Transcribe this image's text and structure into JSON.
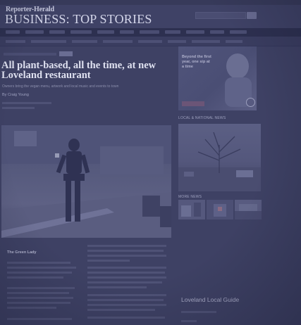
{
  "header": {
    "brand": "Reporter-Herald",
    "section_title": "BUSINESS: TOP STORIES"
  },
  "article": {
    "headline": "All plant-based, all the time, at new Loveland restaurant",
    "deck": "Owners bring the vegan menu, artwork and local music and events to town",
    "byline": "By Craig Young"
  },
  "caption": {
    "title": "The Green Lady"
  },
  "ad": {
    "line1": "Beyond the first",
    "line2": "year, one sip at",
    "line3": "a time"
  },
  "rail": {
    "photo_heading": "LOCAL & NATIONAL NEWS",
    "thumbs_heading": "MORE NEWS",
    "local_guide": "Loveland Local Guide"
  },
  "colors": {
    "header_bg": "#3f4266",
    "nav_bg": "#2d3050",
    "page_bg": "#3e4164"
  }
}
